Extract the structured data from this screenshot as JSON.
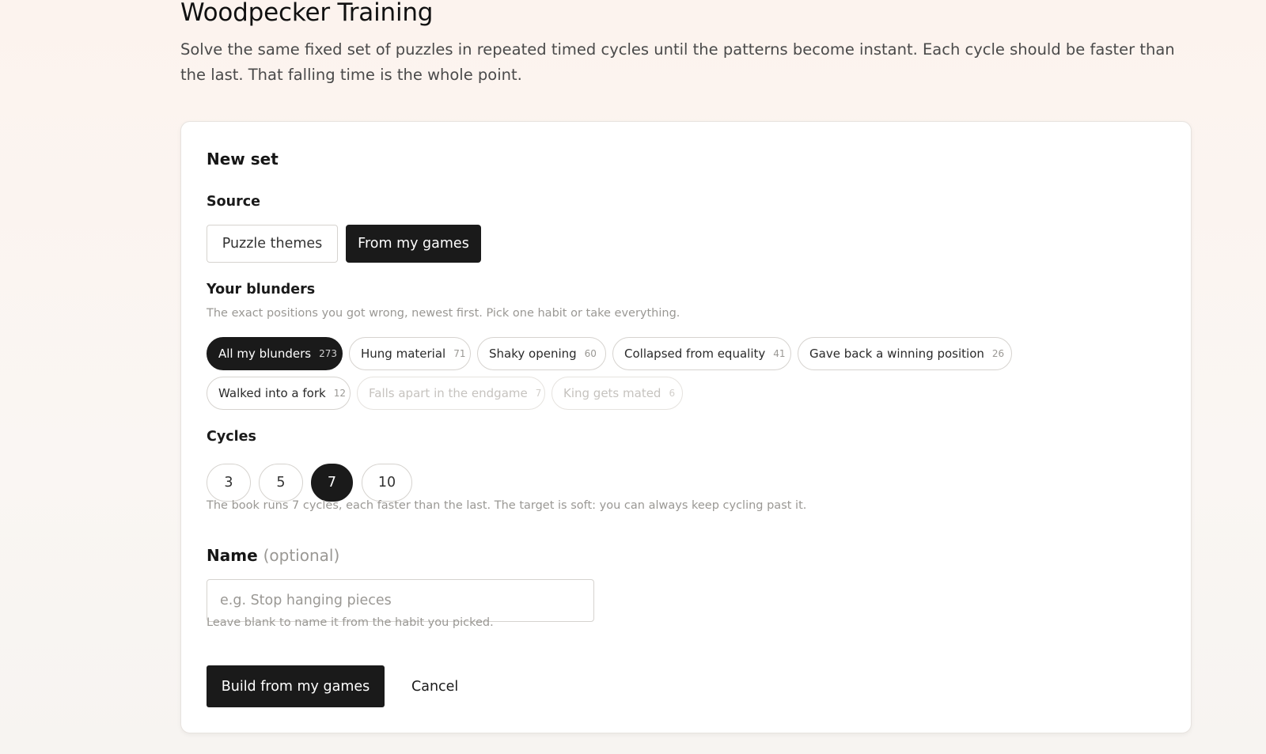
{
  "page": {
    "title": "Woodpecker Training",
    "description": "Solve the same fixed set of puzzles in repeated timed cycles until the patterns become instant. Each cycle should be faster than the last. That falling time is the whole point."
  },
  "card": {
    "title": "New set",
    "source": {
      "label": "Source",
      "options": [
        "Puzzle themes",
        "From my games"
      ],
      "selected": "From my games"
    },
    "blunders": {
      "label": "Your blunders",
      "hint": "The exact positions you got wrong, newest first. Pick one habit or take everything.",
      "chips": [
        {
          "label": "All my blunders",
          "count": "273",
          "state": "active"
        },
        {
          "label": "Hung material",
          "count": "71",
          "state": "normal"
        },
        {
          "label": "Shaky opening",
          "count": "60",
          "state": "normal"
        },
        {
          "label": "Collapsed from equality",
          "count": "41",
          "state": "normal"
        },
        {
          "label": "Gave back a winning position",
          "count": "26",
          "state": "normal"
        },
        {
          "label": "Walked into a fork",
          "count": "12",
          "state": "normal"
        },
        {
          "label": "Falls apart in the endgame",
          "count": "7",
          "state": "disabled"
        },
        {
          "label": "King gets mated",
          "count": "6",
          "state": "disabled"
        }
      ]
    },
    "cycles": {
      "label": "Cycles",
      "options": [
        "3",
        "5",
        "7",
        "10"
      ],
      "selected": "7",
      "hint": "The book runs 7 cycles, each faster than the last. The target is soft: you can always keep cycling past it."
    },
    "name": {
      "label": "Name",
      "optional": "(optional)",
      "value": "",
      "placeholder": "e.g. Stop hanging pieces",
      "hint": "Leave blank to name it from the habit you picked."
    },
    "actions": {
      "primary": "Build from my games",
      "cancel": "Cancel"
    }
  }
}
